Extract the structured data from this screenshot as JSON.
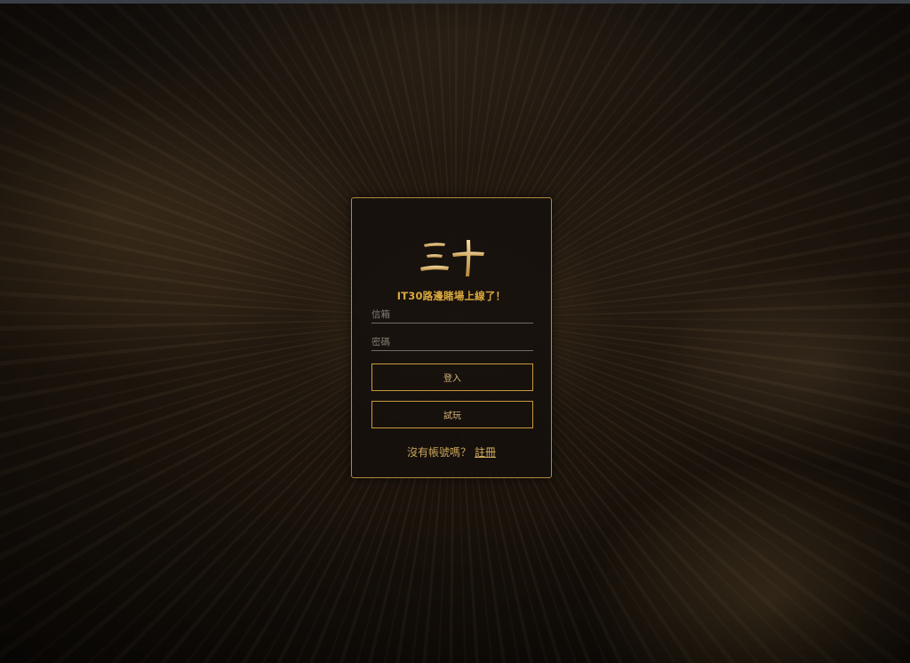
{
  "logo": {
    "text": "三十"
  },
  "login_card": {
    "tagline": "IT30路邊賭場上線了！",
    "email_placeholder": "信箱",
    "password_placeholder": "密碼",
    "login_button": "登入",
    "trial_button": "試玩",
    "register_prompt": "沒有帳號嗎？",
    "register_link": "註冊"
  },
  "colors": {
    "accent_gold": "#d9a83f",
    "card_border": "#b08a3a",
    "background": "#1d1610"
  }
}
